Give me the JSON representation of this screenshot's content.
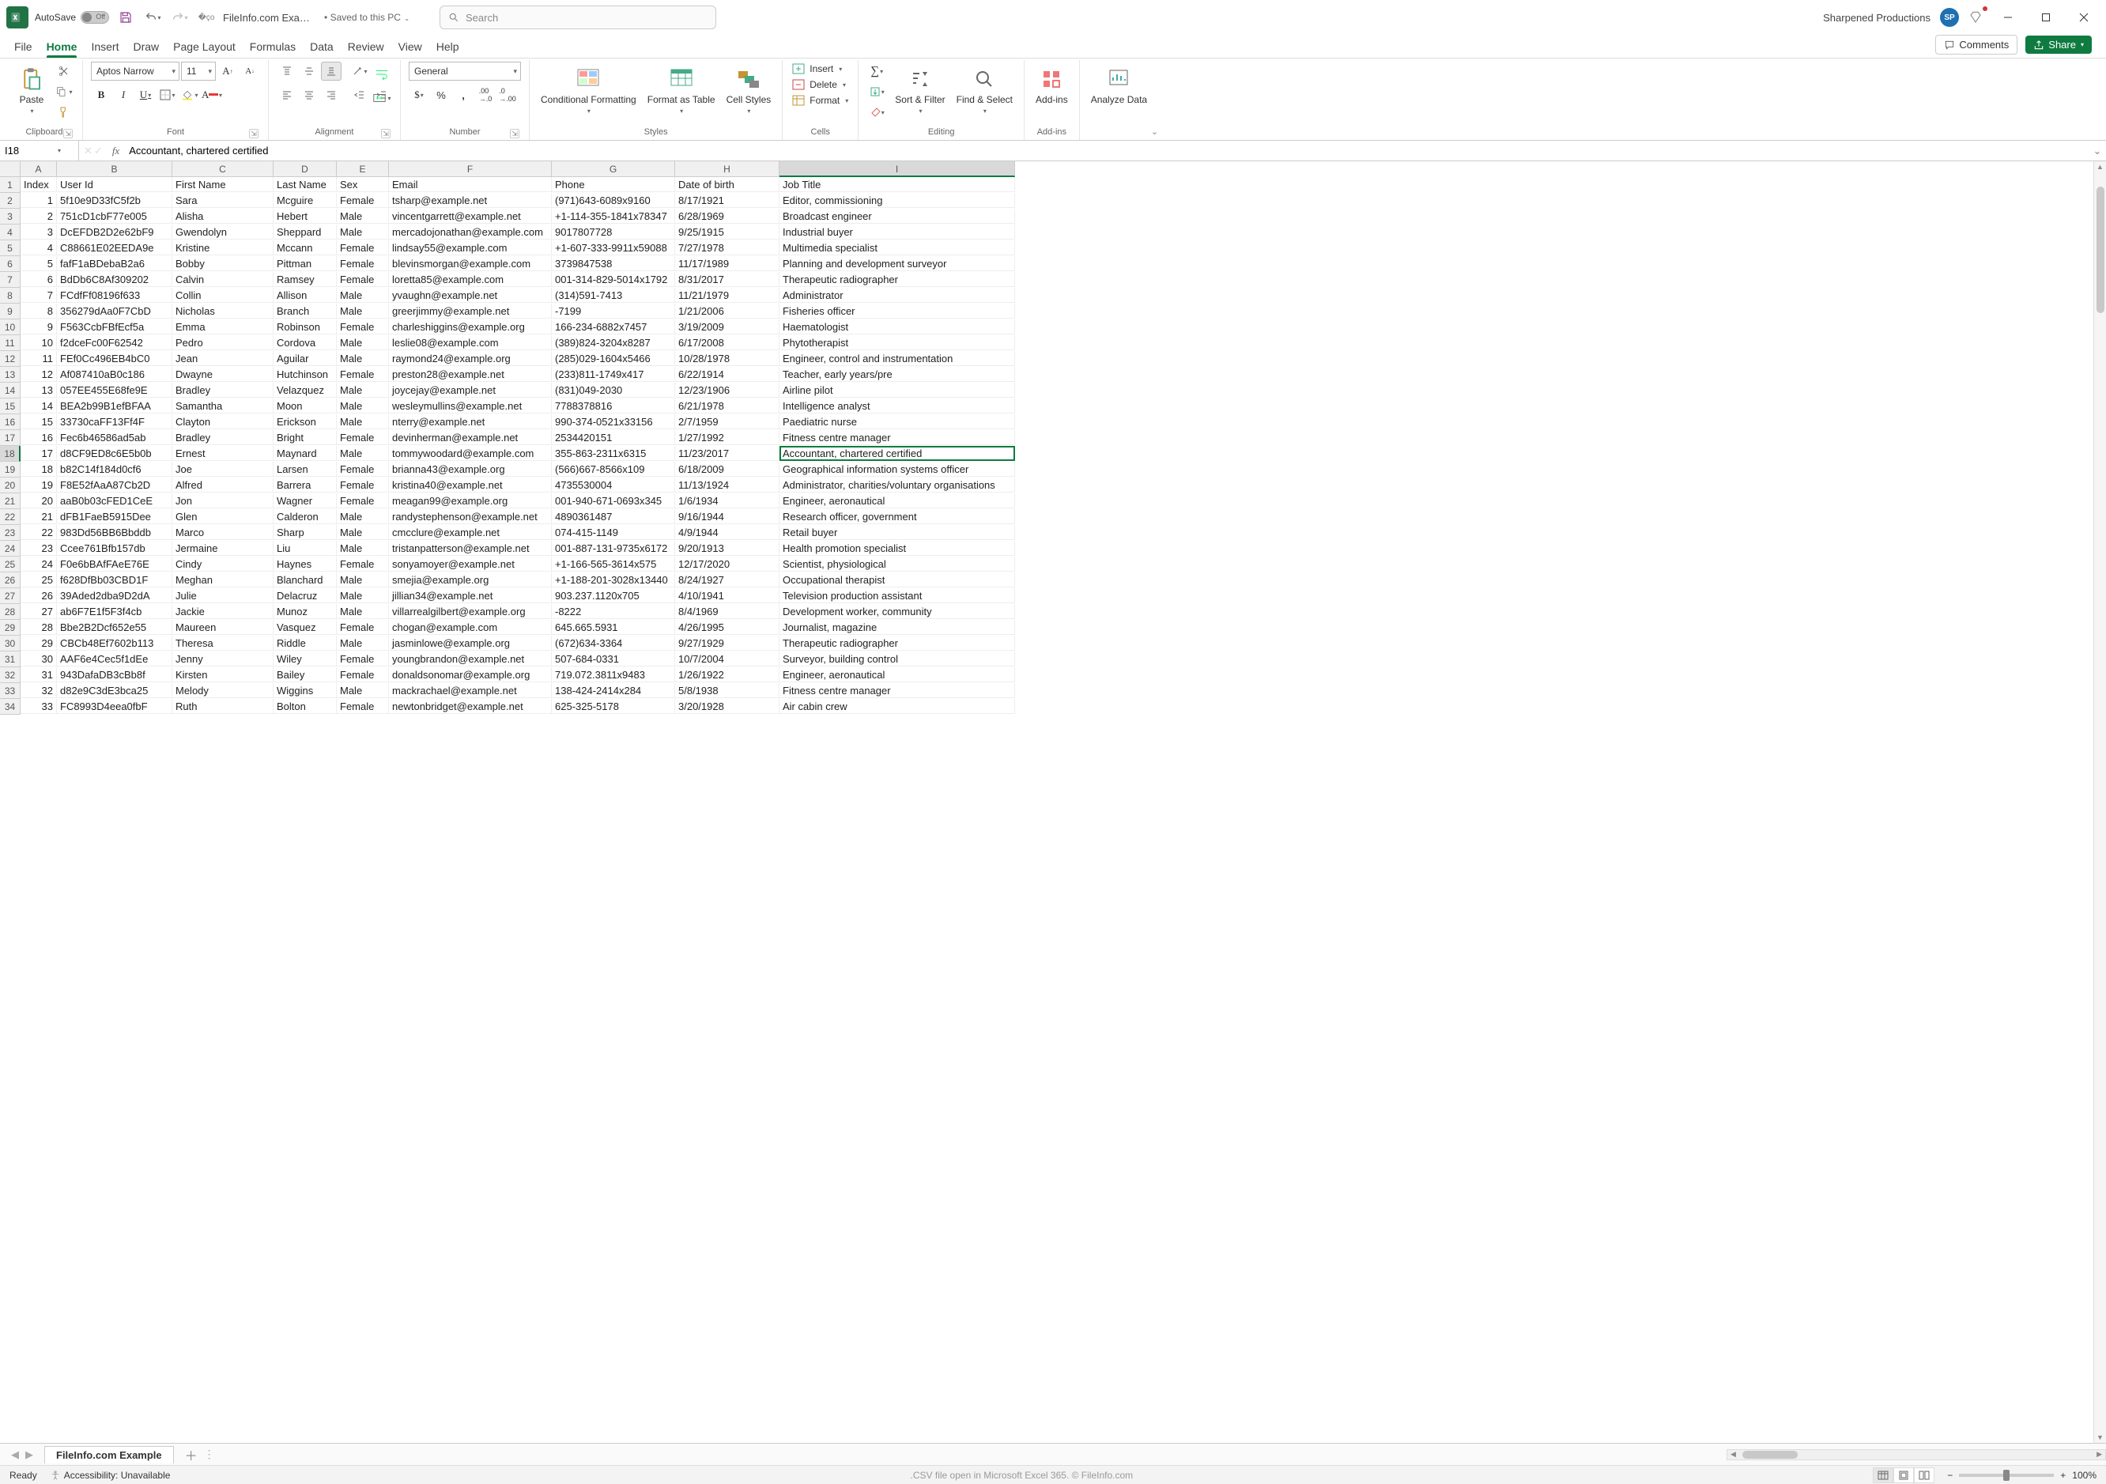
{
  "title_bar": {
    "autosave_label": "AutoSave",
    "autosave_state": "Off",
    "filename": "FileInfo.com Exampl…",
    "saved_to": "• Saved to this PC",
    "search_placeholder": "Search",
    "user_name": "Sharpened Productions",
    "user_initials": "SP"
  },
  "tabs": {
    "file": "File",
    "home": "Home",
    "insert": "Insert",
    "draw": "Draw",
    "page_layout": "Page Layout",
    "formulas": "Formulas",
    "data": "Data",
    "review": "Review",
    "view": "View",
    "help": "Help",
    "comments": "Comments",
    "share": "Share"
  },
  "ribbon": {
    "clipboard": {
      "paste": "Paste",
      "label": "Clipboard"
    },
    "font": {
      "name": "Aptos Narrow",
      "size": "11",
      "label": "Font"
    },
    "alignment": {
      "label": "Alignment"
    },
    "number": {
      "format": "General",
      "label": "Number"
    },
    "styles": {
      "conditional": "Conditional Formatting",
      "table": "Format as Table",
      "cell": "Cell Styles",
      "label": "Styles"
    },
    "cells": {
      "insert": "Insert",
      "delete": "Delete",
      "format": "Format",
      "label": "Cells"
    },
    "editing": {
      "sort": "Sort & Filter",
      "find": "Find & Select",
      "label": "Editing"
    },
    "addins": {
      "addins": "Add-ins",
      "label": "Add-ins"
    },
    "analyze": {
      "analyze": "Analyze Data"
    }
  },
  "formula_bar": {
    "cell_ref": "I18",
    "formula": "Accountant, chartered certified"
  },
  "columns": [
    "A",
    "B",
    "C",
    "D",
    "E",
    "F",
    "G",
    "H",
    "I"
  ],
  "headers": [
    "Index",
    "User Id",
    "First Name",
    "Last Name",
    "Sex",
    "Email",
    "Phone",
    "Date of birth",
    "Job Title"
  ],
  "selected": {
    "row": 18,
    "col": 8
  },
  "rows": [
    [
      1,
      "5f10e9D33fC5f2b",
      "Sara",
      "Mcguire",
      "Female",
      "tsharp@example.net",
      "(971)643-6089x9160",
      "8/17/1921",
      "Editor, commissioning"
    ],
    [
      2,
      "751cD1cbF77e005",
      "Alisha",
      "Hebert",
      "Male",
      "vincentgarrett@example.net",
      "+1-114-355-1841x78347",
      "6/28/1969",
      "Broadcast engineer"
    ],
    [
      3,
      "DcEFDB2D2e62bF9",
      "Gwendolyn",
      "Sheppard",
      "Male",
      "mercadojonathan@example.com",
      "9017807728",
      "9/25/1915",
      "Industrial buyer"
    ],
    [
      4,
      "C88661E02EEDA9e",
      "Kristine",
      "Mccann",
      "Female",
      "lindsay55@example.com",
      "+1-607-333-9911x59088",
      "7/27/1978",
      "Multimedia specialist"
    ],
    [
      5,
      "fafF1aBDebaB2a6",
      "Bobby",
      "Pittman",
      "Female",
      "blevinsmorgan@example.com",
      "3739847538",
      "11/17/1989",
      "Planning and development surveyor"
    ],
    [
      6,
      "BdDb6C8Af309202",
      "Calvin",
      "Ramsey",
      "Female",
      "loretta85@example.com",
      "001-314-829-5014x1792",
      "8/31/2017",
      "Therapeutic radiographer"
    ],
    [
      7,
      "FCdfFf08196f633",
      "Collin",
      "Allison",
      "Male",
      "yvaughn@example.net",
      "(314)591-7413",
      "11/21/1979",
      "Administrator"
    ],
    [
      8,
      "356279dAa0F7CbD",
      "Nicholas",
      "Branch",
      "Male",
      "greerjimmy@example.net",
      "-7199",
      "1/21/2006",
      "Fisheries officer"
    ],
    [
      9,
      "F563CcbFBfEcf5a",
      "Emma",
      "Robinson",
      "Female",
      "charleshiggins@example.org",
      "166-234-6882x7457",
      "3/19/2009",
      "Haematologist"
    ],
    [
      10,
      "f2dceFc00F62542",
      "Pedro",
      "Cordova",
      "Male",
      "leslie08@example.com",
      "(389)824-3204x8287",
      "6/17/2008",
      "Phytotherapist"
    ],
    [
      11,
      "FEf0Cc496EB4bC0",
      "Jean",
      "Aguilar",
      "Male",
      "raymond24@example.org",
      "(285)029-1604x5466",
      "10/28/1978",
      "Engineer, control and instrumentation"
    ],
    [
      12,
      "Af087410aB0c186",
      "Dwayne",
      "Hutchinson",
      "Female",
      "preston28@example.net",
      "(233)811-1749x417",
      "6/22/1914",
      "Teacher, early years/pre"
    ],
    [
      13,
      "057EE455E68fe9E",
      "Bradley",
      "Velazquez",
      "Male",
      "joycejay@example.net",
      "(831)049-2030",
      "12/23/1906",
      "Airline pilot"
    ],
    [
      14,
      "BEA2b99B1efBFAA",
      "Samantha",
      "Moon",
      "Male",
      "wesleymullins@example.net",
      "7788378816",
      "6/21/1978",
      "Intelligence analyst"
    ],
    [
      15,
      "33730caFF13Ff4F",
      "Clayton",
      "Erickson",
      "Male",
      "nterry@example.net",
      "990-374-0521x33156",
      "2/7/1959",
      "Paediatric nurse"
    ],
    [
      16,
      "Fec6b46586ad5ab",
      "Bradley",
      "Bright",
      "Female",
      "devinherman@example.net",
      "2534420151",
      "1/27/1992",
      "Fitness centre manager"
    ],
    [
      17,
      "d8CF9ED8c6E5b0b",
      "Ernest",
      "Maynard",
      "Male",
      "tommywoodard@example.com",
      "355-863-2311x6315",
      "11/23/2017",
      "Accountant, chartered certified"
    ],
    [
      18,
      "b82C14f184d0cf6",
      "Joe",
      "Larsen",
      "Female",
      "brianna43@example.org",
      "(566)667-8566x109",
      "6/18/2009",
      "Geographical information systems officer"
    ],
    [
      19,
      "F8E52fAaA87Cb2D",
      "Alfred",
      "Barrera",
      "Female",
      "kristina40@example.net",
      "4735530004",
      "11/13/1924",
      "Administrator, charities/voluntary organisations"
    ],
    [
      20,
      "aaB0b03cFED1CeE",
      "Jon",
      "Wagner",
      "Female",
      "meagan99@example.org",
      "001-940-671-0693x345",
      "1/6/1934",
      "Engineer, aeronautical"
    ],
    [
      21,
      "dFB1FaeB5915Dee",
      "Glen",
      "Calderon",
      "Male",
      "randystephenson@example.net",
      "4890361487",
      "9/16/1944",
      "Research officer, government"
    ],
    [
      22,
      "983Dd56BB6Bbddb",
      "Marco",
      "Sharp",
      "Male",
      "cmcclure@example.net",
      "074-415-1149",
      "4/9/1944",
      "Retail buyer"
    ],
    [
      23,
      "Ccee761Bfb157db",
      "Jermaine",
      "Liu",
      "Male",
      "tristanpatterson@example.net",
      "001-887-131-9735x6172",
      "9/20/1913",
      "Health promotion specialist"
    ],
    [
      24,
      "F0e6bBAfFAeE76E",
      "Cindy",
      "Haynes",
      "Female",
      "sonyamoyer@example.net",
      "+1-166-565-3614x575",
      "12/17/2020",
      "Scientist, physiological"
    ],
    [
      25,
      "f628DfBb03CBD1F",
      "Meghan",
      "Blanchard",
      "Male",
      "smejia@example.org",
      "+1-188-201-3028x13440",
      "8/24/1927",
      "Occupational therapist"
    ],
    [
      26,
      "39Aded2dba9D2dA",
      "Julie",
      "Delacruz",
      "Male",
      "jillian34@example.net",
      "903.237.1120x705",
      "4/10/1941",
      "Television production assistant"
    ],
    [
      27,
      "ab6F7E1f5F3f4cb",
      "Jackie",
      "Munoz",
      "Male",
      "villarrealgilbert@example.org",
      "-8222",
      "8/4/1969",
      "Development worker, community"
    ],
    [
      28,
      "Bbe2B2Dcf652e55",
      "Maureen",
      "Vasquez",
      "Female",
      "chogan@example.com",
      "645.665.5931",
      "4/26/1995",
      "Journalist, magazine"
    ],
    [
      29,
      "CBCb48Ef7602b113",
      "Theresa",
      "Riddle",
      "Male",
      "jasminlowe@example.org",
      "(672)634-3364",
      "9/27/1929",
      "Therapeutic radiographer"
    ],
    [
      30,
      "AAF6e4Cec5f1dEe",
      "Jenny",
      "Wiley",
      "Female",
      "youngbrandon@example.net",
      "507-684-0331",
      "10/7/2004",
      "Surveyor, building control"
    ],
    [
      31,
      "943DafaDB3cBb8f",
      "Kirsten",
      "Bailey",
      "Female",
      "donaldsonomar@example.org",
      "719.072.3811x9483",
      "1/26/1922",
      "Engineer, aeronautical"
    ],
    [
      32,
      "d82e9C3dE3bca25",
      "Melody",
      "Wiggins",
      "Male",
      "mackrachael@example.net",
      "138-424-2414x284",
      "5/8/1938",
      "Fitness centre manager"
    ],
    [
      33,
      "FC8993D4eea0fbF",
      "Ruth",
      "Bolton",
      "Female",
      "newtonbridget@example.net",
      "625-325-5178",
      "3/20/1928",
      "Air cabin crew"
    ]
  ],
  "sheet": {
    "name": "FileInfo.com Example"
  },
  "status_bar": {
    "ready": "Ready",
    "accessibility": "Accessibility: Unavailable",
    "caption": ".CSV file open in Microsoft Excel 365. © FileInfo.com",
    "zoom": "100%"
  }
}
